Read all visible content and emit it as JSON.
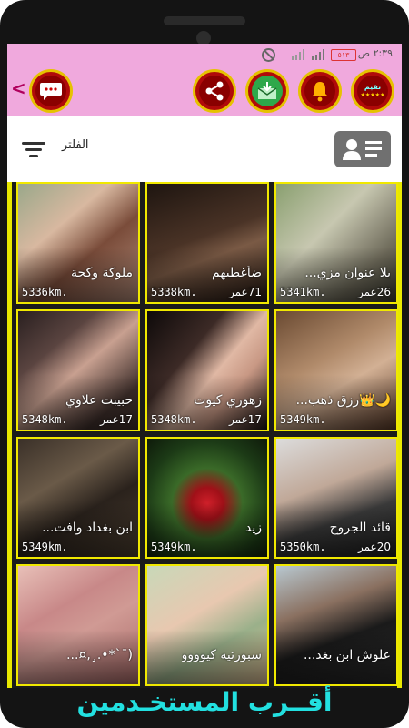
{
  "status_bar": {
    "time": "٢:٣٩ ص",
    "battery": "٥١٣"
  },
  "toolbar": {
    "vip_label": "تقيم",
    "vip_stars": "★★★★★",
    "buttons": [
      "vip",
      "share",
      "message-inbox",
      "notifications"
    ],
    "chat_button": "chat"
  },
  "filter": {
    "label": "الفلتر"
  },
  "users": [
    {
      "name": "بلا عنوان مزي...",
      "age": "26عمر",
      "distance": "5341km."
    },
    {
      "name": "ضأغطيهم",
      "age": "71عمر",
      "distance": "5338km."
    },
    {
      "name": "ملوكة وكحة",
      "age": "",
      "distance": "5336km."
    },
    {
      "name": "🌙👑رزق ذهب...",
      "age": "",
      "distance": "5349km."
    },
    {
      "name": "زهوري كيوت",
      "age": "17عمر",
      "distance": "5348km."
    },
    {
      "name": "حبيبت علاوي",
      "age": "17عمر",
      "distance": "5348km."
    },
    {
      "name": "قائد الجروح",
      "age": "20عمر",
      "distance": "5350km."
    },
    {
      "name": "زيد",
      "age": "",
      "distance": "5349km."
    },
    {
      "name": "ابن بغداد وافت...",
      "age": "",
      "distance": "5349km."
    },
    {
      "name": "علوش ابن بغد...",
      "age": "",
      "distance": ""
    },
    {
      "name": "سبورتيه كيوووو",
      "age": "",
      "distance": ""
    },
    {
      "name": "(¯`*•.¸,¤...",
      "age": "",
      "distance": ""
    }
  ],
  "footer": {
    "title": "أقــرب المستخـدمين"
  },
  "colors": {
    "toolbar_bg": "#f0a9dd",
    "grid_border": "#f0e800",
    "title_color": "#22e0e0"
  }
}
